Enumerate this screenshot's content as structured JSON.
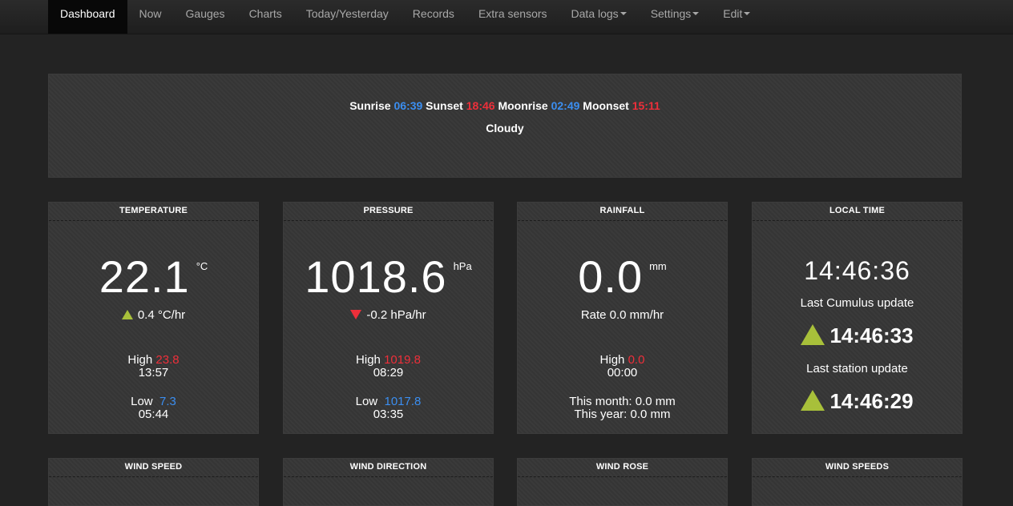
{
  "nav": {
    "items": [
      {
        "label": "Dashboard",
        "active": true
      },
      {
        "label": "Now"
      },
      {
        "label": "Gauges"
      },
      {
        "label": "Charts"
      },
      {
        "label": "Today/Yesterday"
      },
      {
        "label": "Records"
      },
      {
        "label": "Extra sensors"
      },
      {
        "label": "Data logs",
        "dropdown": true
      },
      {
        "label": "Settings",
        "dropdown": true
      },
      {
        "label": "Edit",
        "dropdown": true
      }
    ]
  },
  "astro": {
    "sunrise_label": "Sunrise",
    "sunrise": "06:39",
    "sunset_label": "Sunset",
    "sunset": "18:46",
    "moonrise_label": "Moonrise",
    "moonrise": "02:49",
    "moonset_label": "Moonset",
    "moonset": "15:11",
    "conditions": "Cloudy"
  },
  "temperature": {
    "title": "TEMPERATURE",
    "value": "22.1",
    "unit": "°C",
    "trend": "0.4 °C/hr",
    "trend_dir": "up",
    "high_label": "High",
    "high": "23.8",
    "high_time": "13:57",
    "low_label": "Low",
    "low": "7.3",
    "low_time": "05:44"
  },
  "pressure": {
    "title": "PRESSURE",
    "value": "1018.6",
    "unit": "hPa",
    "trend": "-0.2 hPa/hr",
    "trend_dir": "down",
    "high_label": "High",
    "high": "1019.8",
    "high_time": "08:29",
    "low_label": "Low",
    "low": "1017.8",
    "low_time": "03:35"
  },
  "rainfall": {
    "title": "RAINFALL",
    "value": "0.0",
    "unit": "mm",
    "rate": "Rate 0.0 mm/hr",
    "high_label": "High",
    "high": "0.0",
    "high_time": "00:00",
    "month": "This month: 0.0 mm",
    "year": "This year: 0.0 mm"
  },
  "localtime": {
    "title": "LOCAL TIME",
    "time": "14:46:36",
    "cumulus_label": "Last Cumulus update",
    "cumulus_time": "14:46:33",
    "station_label": "Last station update",
    "station_time": "14:46:29"
  },
  "bottom_cards": {
    "wind_speed": "WIND SPEED",
    "wind_direction": "WIND DIRECTION",
    "wind_rose": "WIND ROSE",
    "wind_speeds": "WIND SPEEDS"
  },
  "colors": {
    "background": "#232323",
    "panel": "#363636",
    "high": "#ee2f3a",
    "low": "#3b8ef0",
    "trend_up": "#a8c03a"
  }
}
